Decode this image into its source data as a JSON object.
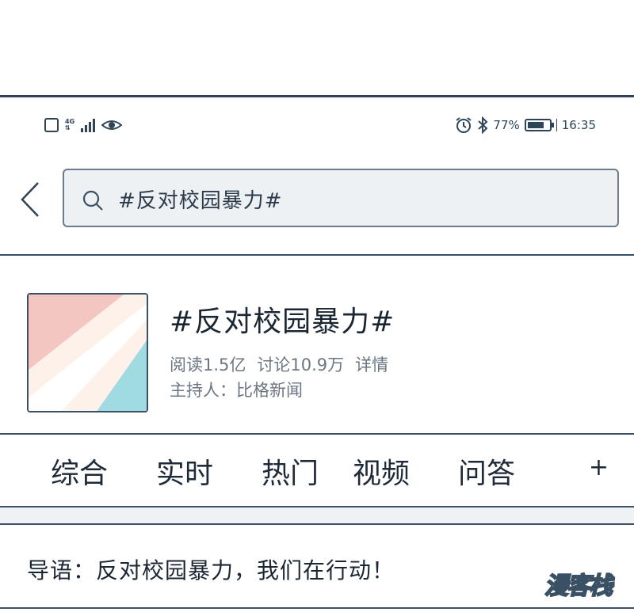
{
  "status_bar": {
    "network": "4G",
    "battery_percent_label": "77%",
    "battery_level": 0.77,
    "time": "16:35"
  },
  "search": {
    "query": "#反对校园暴力#"
  },
  "topic": {
    "title": "#反对校园暴力#",
    "reads": "阅读1.5亿",
    "discussions": "讨论10.9万",
    "details_link": "详情",
    "host": "主持人：比格新闻"
  },
  "tabs": [
    "综合",
    "实时",
    "热门",
    "视频",
    "问答"
  ],
  "tab_more": "+",
  "intro_text": "导语：反对校园暴力，我们在行动！",
  "watermark": "漫客栈",
  "colors": {
    "line": "#3a5064",
    "cover_pink": "#f4c6c2",
    "cover_cream": "#fdf1ea",
    "cover_teal": "#9fdbe0"
  }
}
